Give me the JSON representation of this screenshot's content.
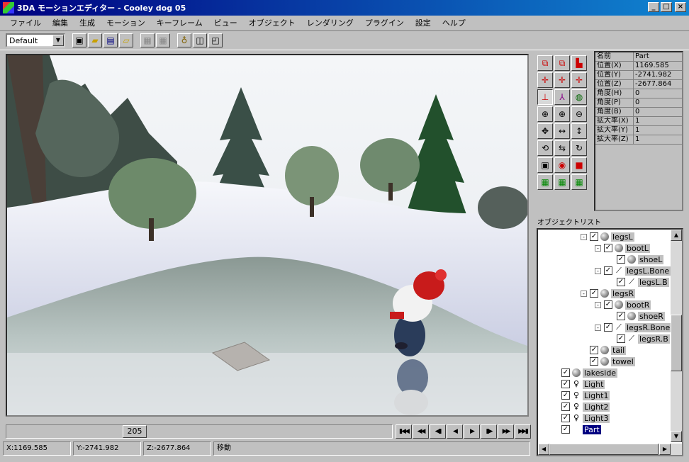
{
  "window": {
    "title": "3DA モーションエディター - Cooley dog 05",
    "minimize": "_",
    "maximize": "□",
    "close": "×"
  },
  "menu": [
    "ファイル",
    "編集",
    "生成",
    "モーション",
    "キーフレーム",
    "ビュー",
    "オブジェクト",
    "レンダリング",
    "プラグイン",
    "設定",
    "ヘルプ"
  ],
  "toolbar": {
    "view_select": "Default"
  },
  "timeline": {
    "frame": "205"
  },
  "status": {
    "x": "X:1169.585",
    "y": "Y:-2741.982",
    "z": "Z:-2677.864",
    "mode": "移動"
  },
  "properties": {
    "header": {
      "name": "名前",
      "value": "Part"
    },
    "rows": [
      {
        "name": "位置(X)",
        "value": "1169.585"
      },
      {
        "name": "位置(Y)",
        "value": "-2741.982"
      },
      {
        "name": "位置(Z)",
        "value": "-2677.864"
      },
      {
        "name": "角度(H)",
        "value": "0"
      },
      {
        "name": "角度(P)",
        "value": "0"
      },
      {
        "name": "角度(B)",
        "value": "0"
      },
      {
        "name": "拡大率(X)",
        "value": "1"
      },
      {
        "name": "拡大率(Y)",
        "value": "1"
      },
      {
        "name": "拡大率(Z)",
        "value": "1"
      }
    ]
  },
  "object_list": {
    "label": "オブジェクトリスト",
    "items": [
      {
        "name": "legsL",
        "icon": "sphere",
        "expand": "-"
      },
      {
        "name": "bootL",
        "icon": "sphere",
        "expand": "-"
      },
      {
        "name": "shoeL",
        "icon": "sphere",
        "expand": ""
      },
      {
        "name": "legsL.Bone",
        "icon": "bone",
        "expand": "-"
      },
      {
        "name": "legsL.B",
        "icon": "bone",
        "expand": ""
      },
      {
        "name": "legsR",
        "icon": "sphere",
        "expand": "-"
      },
      {
        "name": "bootR",
        "icon": "sphere",
        "expand": "-"
      },
      {
        "name": "shoeR",
        "icon": "sphere",
        "expand": ""
      },
      {
        "name": "legsR.Bone",
        "icon": "bone",
        "expand": "-"
      },
      {
        "name": "legsR.B",
        "icon": "bone",
        "expand": ""
      },
      {
        "name": "tail",
        "icon": "sphere",
        "expand": ""
      },
      {
        "name": "towel",
        "icon": "sphere",
        "expand": ""
      },
      {
        "name": "lakeside",
        "icon": "sphere",
        "expand": ""
      },
      {
        "name": "Light",
        "icon": "bulb",
        "expand": ""
      },
      {
        "name": "Light1",
        "icon": "bulb",
        "expand": ""
      },
      {
        "name": "Light2",
        "icon": "bulb",
        "expand": ""
      },
      {
        "name": "Light3",
        "icon": "bulb",
        "expand": ""
      },
      {
        "name": "Part",
        "icon": "",
        "expand": ""
      }
    ]
  }
}
